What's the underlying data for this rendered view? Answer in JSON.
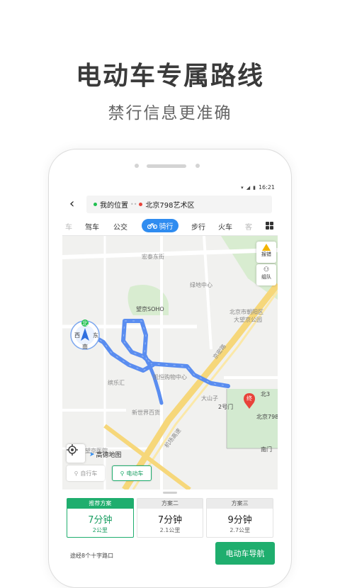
{
  "promo": {
    "headline": "电动车专属路线",
    "subline": "禁行信息更准确"
  },
  "status_bar": {
    "time": "16:21"
  },
  "route": {
    "from": "我的位置",
    "to": "北京798艺术区"
  },
  "modes": [
    {
      "label": "车",
      "faded": true
    },
    {
      "label": "驾车"
    },
    {
      "label": "公交"
    },
    {
      "label": "骑行",
      "active": true
    },
    {
      "label": "步行"
    },
    {
      "label": "火车"
    },
    {
      "label": "客",
      "faded": true
    }
  ],
  "map": {
    "labels": {
      "hongtai": "宏泰东街",
      "lvdi": "绿地中心",
      "wangjing_soho": "望京SOHO",
      "beijing_chaoyang": "北京市朝阳区",
      "dawangjing": "大望京公园",
      "jingmi": "京密路",
      "kaiheng": "凯恒购物中心",
      "kaile": "缤乐汇",
      "dashanzi": "大山子",
      "gate2": "2号门",
      "beijing798": "北京798",
      "xinshijie": "新世界百货",
      "nanmen": "南门",
      "bei3": "北3",
      "hospital": "望京医院",
      "jichang": "机场高速",
      "compass_west": "西",
      "compass_east": "东",
      "compass_south": "南",
      "compass_north": "北",
      "end_marker": "终"
    },
    "side_buttons": {
      "report": "报错",
      "team": "组队"
    },
    "logo": "高德地图",
    "vehicle_bike": "自行车",
    "vehicle_ebike": "电动车"
  },
  "plans": [
    {
      "title": "推荐方案",
      "time": "7分钟",
      "distance": "2公里",
      "active": true
    },
    {
      "title": "方案二",
      "time": "7分钟",
      "distance": "2.1公里"
    },
    {
      "title": "方案三",
      "time": "9分钟",
      "distance": "2.7公里"
    }
  ],
  "via": "途经8个十字路口",
  "nav_button": "电动车导航",
  "colors": {
    "accent_green": "#1fae6e",
    "active_mode_blue": "#2f8cf0",
    "route_blue": "#4a86f0",
    "start_green": "#1fbf4f",
    "end_red": "#e8433a"
  }
}
